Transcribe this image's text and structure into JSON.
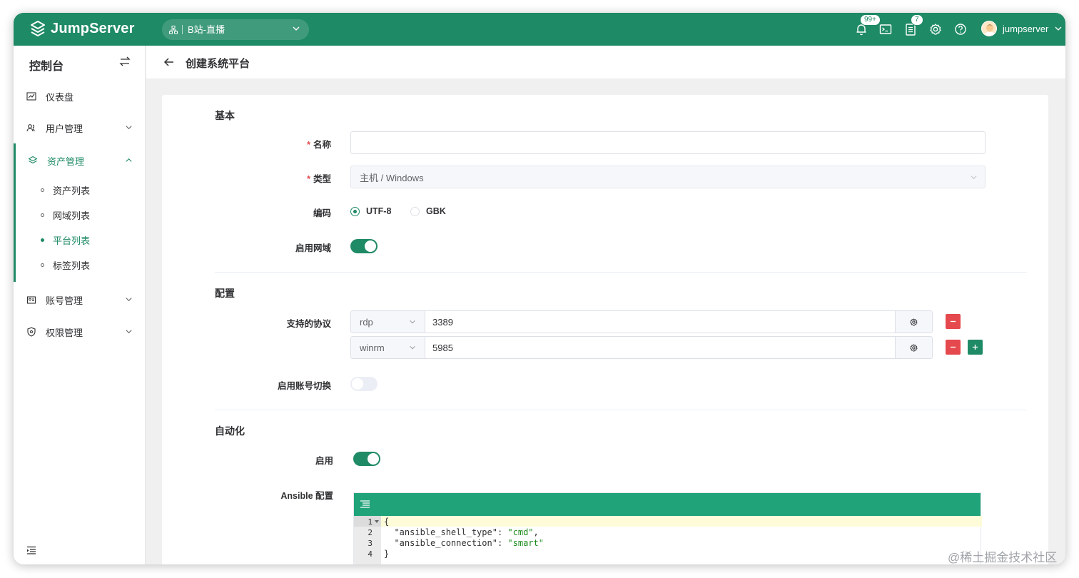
{
  "app": {
    "brand": "JumpServer",
    "org": "B站-直播"
  },
  "topbar": {
    "notify_badge": "99+",
    "tasks_badge": "7",
    "username": "jumpserver"
  },
  "sidebar": {
    "title": "控制台",
    "items": [
      {
        "label": "仪表盘"
      },
      {
        "label": "用户管理"
      },
      {
        "label": "资产管理"
      },
      {
        "label": "账号管理"
      },
      {
        "label": "权限管理"
      }
    ],
    "asset_subitems": [
      {
        "label": "资产列表"
      },
      {
        "label": "网域列表"
      },
      {
        "label": "平台列表"
      },
      {
        "label": "标签列表"
      }
    ]
  },
  "page": {
    "title": "创建系统平台"
  },
  "form": {
    "basic": {
      "section": "基本",
      "name_label": "名称",
      "type_label": "类型",
      "type_value": "主机 / Windows",
      "charset_label": "编码",
      "charset_options": [
        "UTF-8",
        "GBK"
      ],
      "charset_selected": "UTF-8",
      "domain_label": "启用网域",
      "domain_enabled": true
    },
    "config": {
      "section": "配置",
      "protocols_label": "支持的协议",
      "protocols": [
        {
          "name": "rdp",
          "port": "3389"
        },
        {
          "name": "winrm",
          "port": "5985"
        }
      ],
      "su_label": "启用账号切换",
      "su_enabled": false
    },
    "automation": {
      "section": "自动化",
      "enable_label": "启用",
      "enabled": true,
      "ansible_label": "Ansible 配置",
      "code_lines": [
        "1",
        "2",
        "3",
        "4"
      ]
    }
  },
  "watermark": "@稀土掘金技术社区",
  "colors": {
    "primary": "#1f8a66",
    "danger": "#e5484d",
    "editor_bar": "#21a37a"
  }
}
